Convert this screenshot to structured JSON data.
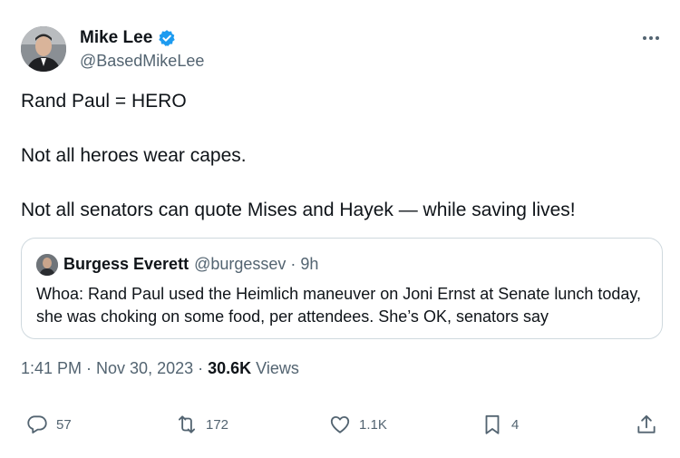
{
  "author": {
    "name": "Mike Lee",
    "handle": "@BasedMikeLee"
  },
  "tweet": {
    "lines": [
      "Rand Paul = HERO",
      "Not all heroes wear capes.",
      "Not all senators can quote Mises and Hayek — while saving lives!"
    ],
    "timestamp": "1:41 PM · Nov 30, 2023 ·",
    "views_count": "30.6K",
    "views_label": "Views"
  },
  "quoted": {
    "name": "Burgess Everett",
    "meta": "@burgessev · 9h",
    "text": "Whoa: Rand Paul used the Heimlich maneuver on Joni Ernst at Senate lunch today, she was choking on some food, per attendees. She’s OK, senators say"
  },
  "actions": {
    "replies": "57",
    "reposts": "172",
    "likes": "1.1K",
    "bookmarks": "4"
  },
  "colors": {
    "verified": "#1d9bf0",
    "text_primary": "#0f1419",
    "text_secondary": "#536471",
    "border": "#cfd9de"
  },
  "icons": [
    "verified-icon",
    "more-icon",
    "reply-icon",
    "repost-icon",
    "like-icon",
    "bookmark-icon",
    "share-icon"
  ]
}
